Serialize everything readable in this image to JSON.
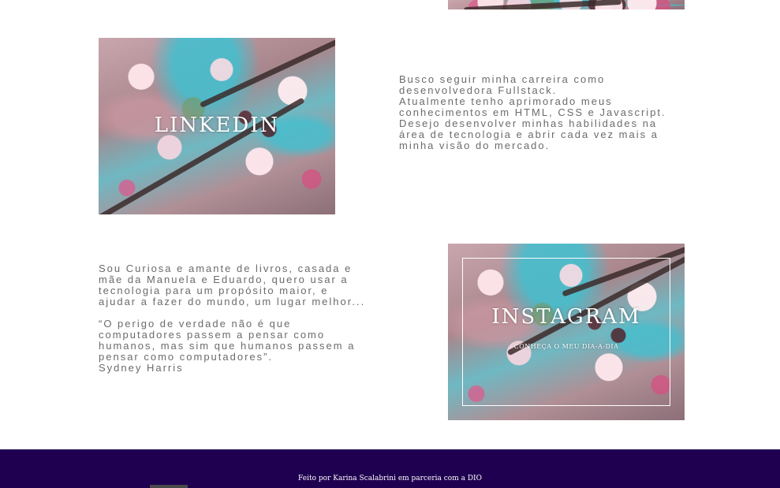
{
  "projects": {
    "linkedin": {
      "title": "LINKEDIN"
    },
    "instagram": {
      "title": "INSTAGRAM",
      "subtitle": "CONHEÇA O MEU DIA-A-DIA"
    }
  },
  "career": {
    "lines": [
      "Busco seguir minha carreira como",
      "desenvolvedora Fullstack.",
      "Atualmente tenho aprimorado meus",
      "conhecimentos em HTML, CSS e Javascript.",
      "Desejo desenvolver minhas habilidades na",
      "área de tecnologia e abrir cada vez mais a",
      "minha visão do mercado."
    ]
  },
  "about": {
    "intro_lines": [
      "Sou Curiosa e amante de livros, casada e",
      "mãe da Manuela e Eduardo, quero usar a",
      "tecnologia para um propósito maior, e",
      "ajudar a fazer do mundo, um lugar melhor..."
    ],
    "quote_lines": [
      "“O perigo de verdade não é que",
      "computadores passem a pensar como",
      "humanos, mas sim que humanos passem a",
      "pensar como computadores”."
    ],
    "quote_author": "Sydney Harris"
  },
  "footer": {
    "credit": "Feito por Karina Scalabrini em parceria com a DIO"
  },
  "colors": {
    "footer_background": "#1f0050",
    "body_text": "#6b6b6b",
    "overlay_text": "#ffffff"
  }
}
